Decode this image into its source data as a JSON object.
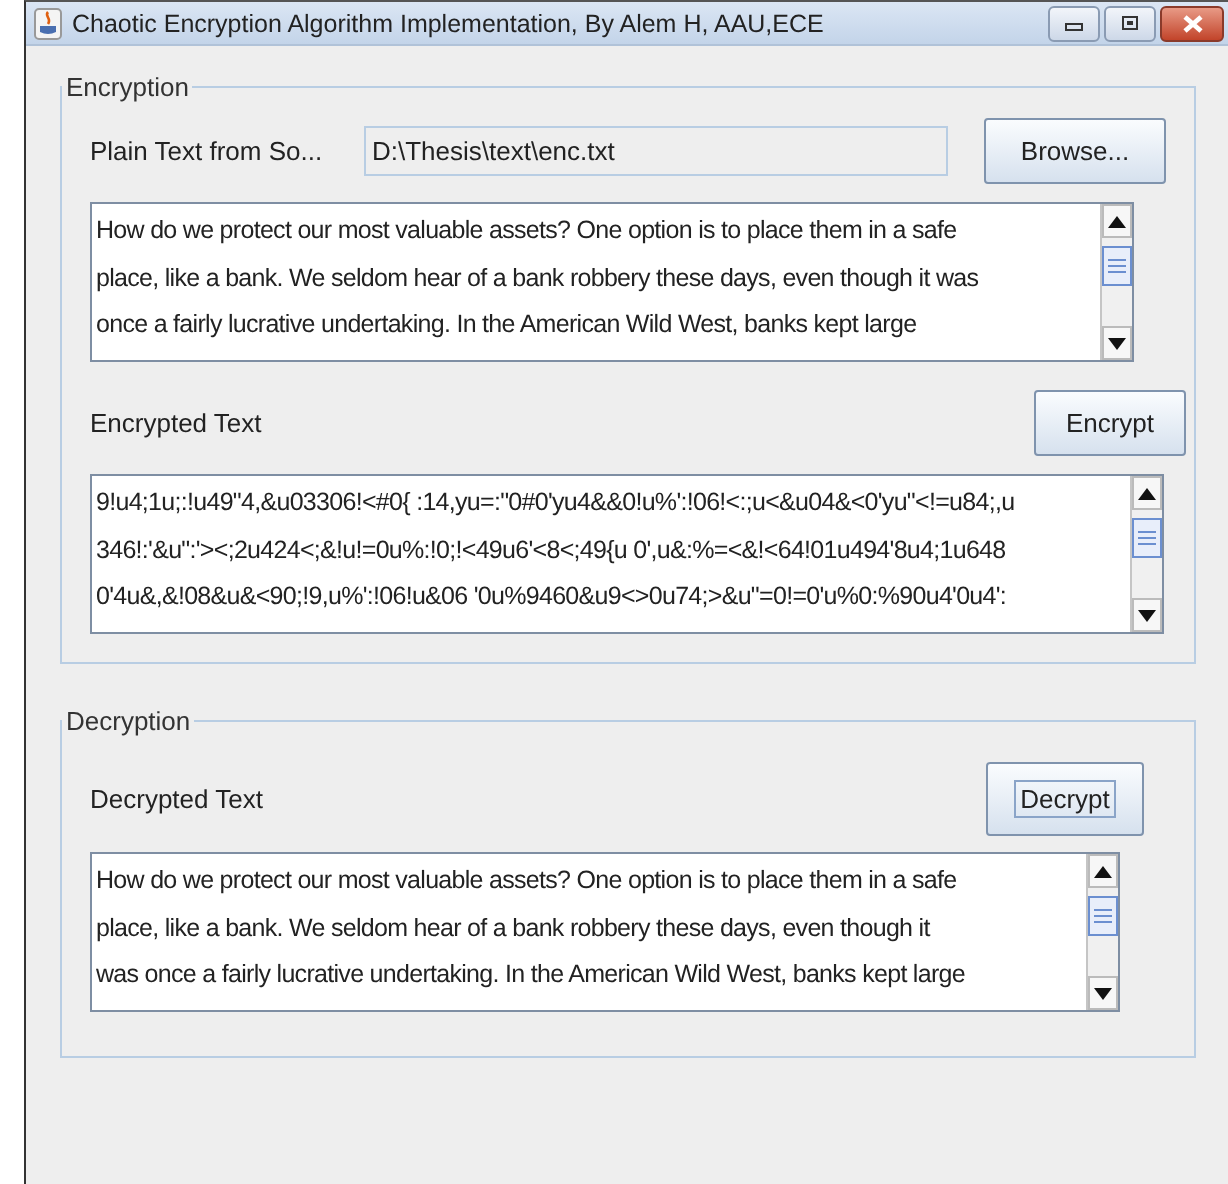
{
  "window": {
    "title": "Chaotic Encryption Algorithm Implementation, By Alem H, AAU,ECE"
  },
  "encryption": {
    "title": "Encryption",
    "source_label": "Plain Text from So...",
    "source_path": "D:\\Thesis\\text\\enc.txt",
    "browse_button": {
      "label": "Browse...",
      "focused": false
    },
    "plain_text": {
      "lines": [
        "How do we protect our most valuable assets? One option is to place them in a safe",
        "place, like a bank. We seldom hear of a bank robbery these days, even though it was",
        "once a fairly lucrative undertaking. In the American Wild West, banks kept large"
      ]
    },
    "encrypted_label": "Encrypted Text",
    "encrypt_button": {
      "label": "Encrypt",
      "focused": false
    },
    "encrypted_text": {
      "lines": [
        "9!u4;1u;:!u49\"4,&u03306!<#0{  :14,yu=:\"0#0'yu4&&0!u%':!06!<:;u<&u04&<0'yu\"<!=u84;,u",
        "346!:'&u\":'><;2u424<;&!u!=0u%:!0;!<49u6'<8<;49{u  0',u&:%=<&!<64!01u494'8u4;1u648",
        "0'4u&,&!08&u&<90;!9,u%':!06!u&06 '0u%9460&u9<>0u74;>&u\"=0!=0'u%0:%90u4'0u4':"
      ]
    }
  },
  "decryption": {
    "title": "Decryption",
    "decrypted_label": "Decrypted Text",
    "decrypt_button": {
      "label": "Decrypt",
      "focused": true
    },
    "decrypted_text": {
      "lines": [
        "How do we protect our most valuable assets? One option is to place them in a safe",
        "place, like a bank. We seldom hear of a bank robbery these days, even though it",
        "was once a fairly lucrative undertaking. In the American Wild West, banks kept large"
      ]
    }
  }
}
